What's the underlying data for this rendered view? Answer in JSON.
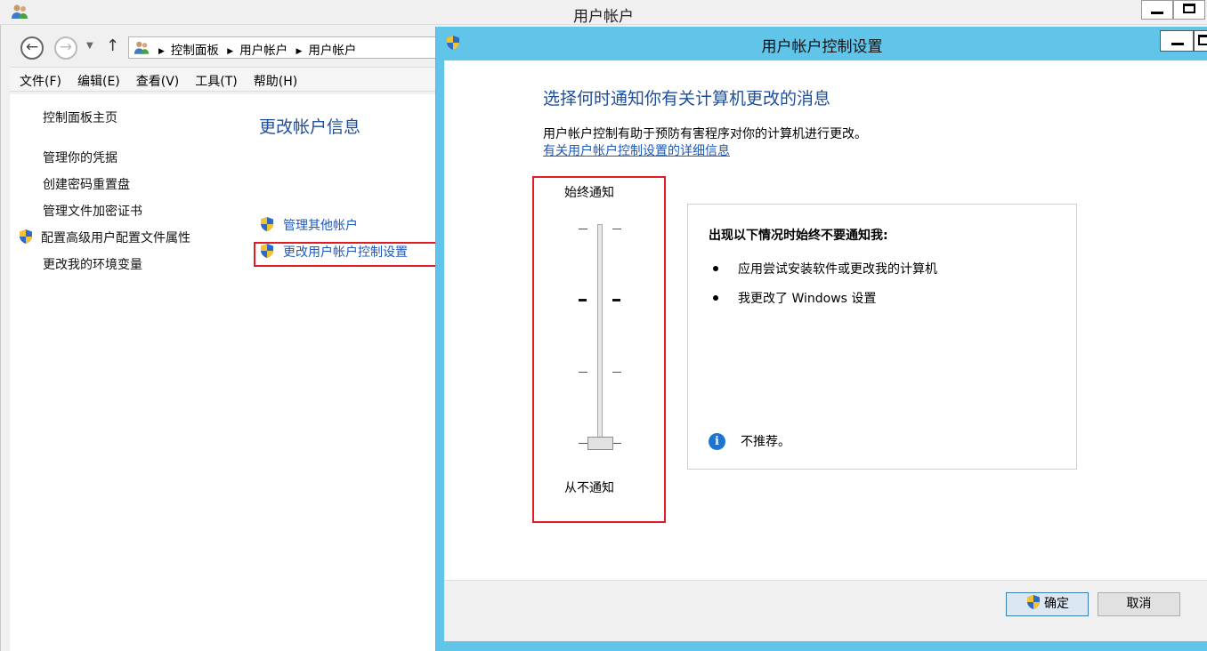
{
  "back_window": {
    "title": "用户帐户",
    "breadcrumbs": [
      "控制面板",
      "用户帐户",
      "用户帐户"
    ],
    "menu": [
      "文件(F)",
      "编辑(E)",
      "查看(V)",
      "工具(T)",
      "帮助(H)"
    ],
    "sidebar": [
      {
        "label": "控制面板主页"
      },
      {
        "label": "管理你的凭据"
      },
      {
        "label": "创建密码重置盘"
      },
      {
        "label": "管理文件加密证书"
      },
      {
        "label": "配置高级用户配置文件属性",
        "icon": "shield-icon"
      },
      {
        "label": "更改我的环境变量"
      }
    ],
    "heading": "更改帐户信息",
    "tasks": [
      {
        "label": "管理其他帐户",
        "icon": "shield-icon"
      },
      {
        "label": "更改用户帐户控制设置",
        "icon": "shield-icon"
      }
    ]
  },
  "dialog": {
    "title": "用户帐户控制设置",
    "heading": "选择何时通知你有关计算机更改的消息",
    "description": "用户帐户控制有助于预防有害程序对你的计算机进行更改。",
    "link": "有关用户帐户控制设置的详细信息",
    "slider": {
      "top_label": "始终通知",
      "bottom_label": "从不通知",
      "levels": 4,
      "selected_level": 1
    },
    "info": {
      "title": "出现以下情况时始终不要通知我:",
      "bullets": [
        "应用尝试安装软件或更改我的计算机",
        "我更改了 Windows 设置"
      ],
      "note": "不推荐。"
    },
    "buttons": {
      "ok": "确定",
      "cancel": "取消"
    }
  },
  "colors": {
    "link": "#1f58b8",
    "heading": "#1e4f9c",
    "highlight": "#e31b23",
    "dialog_frame": "#61c5ea"
  }
}
